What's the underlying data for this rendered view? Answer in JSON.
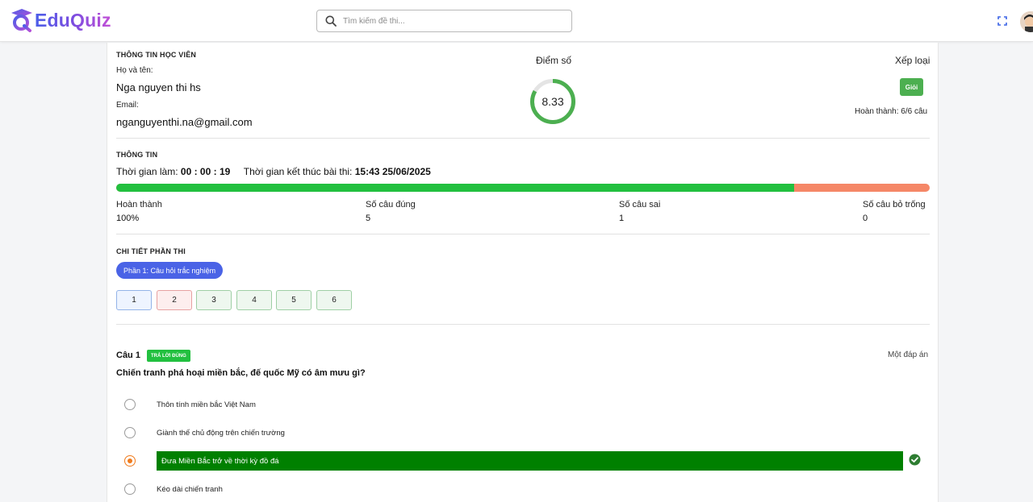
{
  "header": {
    "logo_text": "EduQuiz",
    "search_placeholder": "Tìm kiếm đề thi...",
    "icons": [
      "search-icon",
      "fullscreen-icon",
      "avatar"
    ]
  },
  "student": {
    "section_title": "THÔNG TIN HỌC VIÊN",
    "name_label": "Họ và tên:",
    "name": "Nga nguyen thi hs",
    "email_label": "Email:",
    "email": "nganguyenthi.na@gmail.com"
  },
  "score": {
    "title": "Điểm số",
    "value": "8.33",
    "ring_fraction": 0.833
  },
  "grade": {
    "title": "Xếp loại",
    "badge": "Giỏi",
    "completion": "Hoàn thành: 6/6 câu"
  },
  "info": {
    "section_title": "THÔNG TIN",
    "time_label": "Thời gian làm:",
    "time_value": "00 : 00 : 19",
    "end_label": "Thời gian kết thúc bài thi:",
    "end_value": "15:43 25/06/2025",
    "progress_fraction": 0.833,
    "stats": [
      {
        "label": "Hoàn thành",
        "value": "100%"
      },
      {
        "label": "Số câu đúng",
        "value": "5"
      },
      {
        "label": "Số câu sai",
        "value": "1"
      },
      {
        "label": "Số câu bỏ trống",
        "value": "0"
      }
    ]
  },
  "parts": {
    "section_title": "CHI TIẾT PHẦN THI",
    "active_part": "Phần 1: Câu hỏi trắc nghiệm",
    "questions": [
      "1",
      "2",
      "3",
      "4",
      "5",
      "6"
    ]
  },
  "question": {
    "number": "Câu 1",
    "status_tag": "TRẢ LỜI ĐÚNG",
    "type": "Một đáp án",
    "text": "Chiến tranh phá hoại miền bắc, đế quốc Mỹ có âm mưu gì?",
    "options": [
      "Thôn tính miền bắc Việt Nam",
      "Giành thế chủ động trên chiến trường",
      "Đưa Miền Bắc trở về thời kỳ đồ đá",
      "Kéo dài chiến tranh"
    ],
    "selected_index": 2
  },
  "colors": {
    "brand": "#4b5ee8",
    "correct": "#22c03f",
    "wrong": "#f58767",
    "selected_answer": "#008000",
    "radio_selected": "#f07b1d"
  }
}
